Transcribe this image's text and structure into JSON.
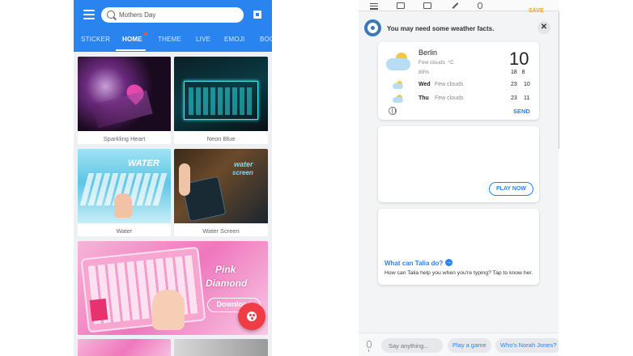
{
  "left_app": {
    "search": {
      "value": "Mothers Day",
      "placeholder": "Search"
    },
    "tabs": [
      {
        "label": "STICKER"
      },
      {
        "label": "HOME"
      },
      {
        "label": "THEME"
      },
      {
        "label": "LIVE"
      },
      {
        "label": "EMOJI"
      },
      {
        "label": "BOO"
      }
    ],
    "active_tab": "HOME",
    "themes": [
      {
        "label": "Sparkling Heart"
      },
      {
        "label": "Neon Blue"
      },
      {
        "label": "Water"
      },
      {
        "label": "Water Screen"
      }
    ],
    "banner": {
      "title_line1": "Pink",
      "title_line2": "Diamond",
      "button": "Download"
    },
    "overlay_water": "WATER",
    "overlay_waterscreen_1": "water",
    "overlay_waterscreen_2": "screen",
    "colors": {
      "primary": "#2a84f0",
      "fab": "#ef3c45"
    }
  },
  "right_app": {
    "save_label": "SAVE",
    "header_message": "You may need some weather facts.",
    "close_label": "✕",
    "weather": {
      "city": "Berlin",
      "condition": "Few clouds",
      "unit": "°C",
      "humidity": "89%",
      "temp": "10",
      "high": "18",
      "low": "8",
      "forecast": [
        {
          "day": "Wed",
          "condition": "Few clouds",
          "high": "23",
          "low": "10"
        },
        {
          "day": "Thu",
          "condition": "Few clouds",
          "high": "23",
          "low": "11"
        }
      ],
      "send_label": "SEND"
    },
    "game": {
      "play_label": "PLAY NOW"
    },
    "talia": {
      "question": "What can Talia do?",
      "arrow": "→",
      "description": "How can Talia help you when you're typing? Tap to know her."
    },
    "bottom": {
      "input_placeholder": "Say anything...",
      "suggestions": [
        "Play a game",
        "Who's Norah Jones?"
      ]
    },
    "colors": {
      "accent": "#2a84f0",
      "save": "#e9a23b"
    }
  }
}
